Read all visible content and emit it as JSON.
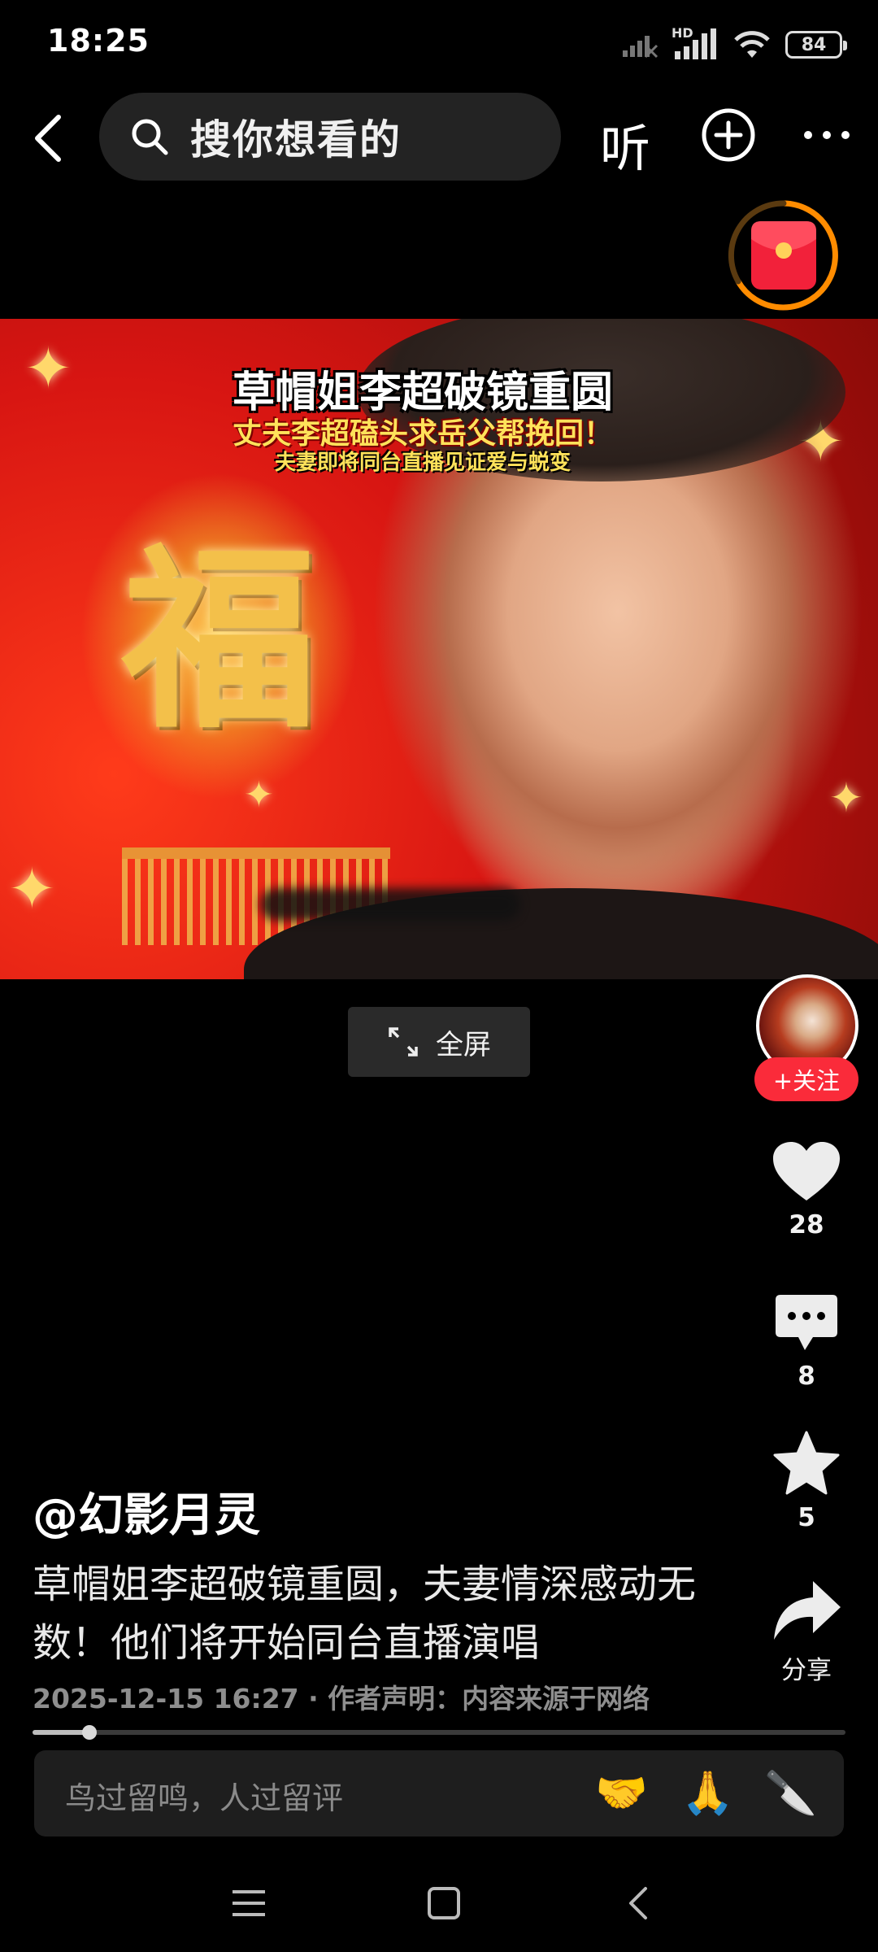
{
  "status_bar": {
    "time": "18:25",
    "battery": "84",
    "network_label": "HD"
  },
  "search": {
    "placeholder": "搜你想看的"
  },
  "top_nav": {
    "listen_label": "听"
  },
  "video": {
    "overlay_title": "草帽姐李超破镜重圆",
    "overlay_subtitle": "丈夫李超磕头求岳父帮挽回！",
    "overlay_caption": "夫妻即将同台直播见证爱与蜕变",
    "sign_character": "福"
  },
  "fullscreen": {
    "label": "全屏"
  },
  "right_rail": {
    "follow_label": "+关注",
    "like_count": "28",
    "comment_count": "8",
    "favorite_count": "5",
    "share_label": "分享"
  },
  "post": {
    "author": "@幻影月灵",
    "description": "草帽姐李超破镜重圆，夫妻情深感动无数！他们将开始同台直播演唱",
    "meta": "2025-12-15 16:27 · 作者声明：内容来源于网络",
    "progress": 0.07
  },
  "comment_bar": {
    "placeholder": "鸟过留鸣，人过留评",
    "emojis": [
      "🤝",
      "🙏",
      "🔪"
    ]
  },
  "colors": {
    "accent_red": "#fa2b3a",
    "redpacket_ring": "#ff8c00",
    "background": "#000000"
  }
}
